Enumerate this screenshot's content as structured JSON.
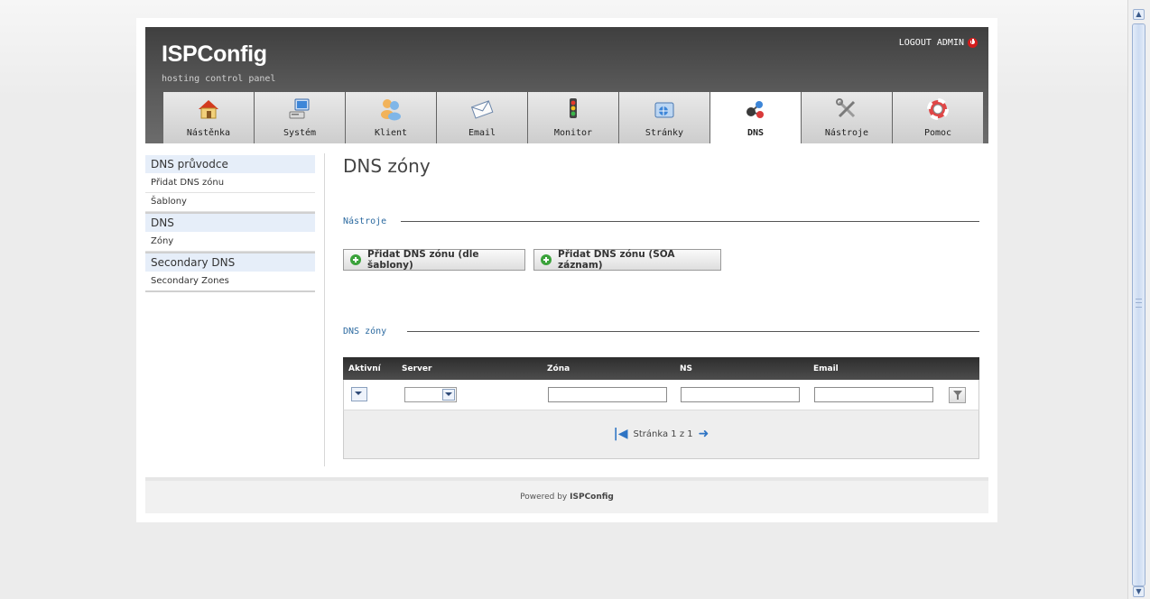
{
  "header": {
    "logo": "ISPConfig",
    "tagline": "hosting control panel",
    "logout_label": "LOGOUT ADMIN"
  },
  "tabs": [
    {
      "label": "Nástěnka",
      "icon": "home-icon"
    },
    {
      "label": "Systém",
      "icon": "computer-icon"
    },
    {
      "label": "Klient",
      "icon": "users-icon"
    },
    {
      "label": "Email",
      "icon": "envelope-icon"
    },
    {
      "label": "Monitor",
      "icon": "traffic-light-icon"
    },
    {
      "label": "Stránky",
      "icon": "web-folder-icon"
    },
    {
      "label": "DNS",
      "icon": "dns-molecule-icon",
      "active": true
    },
    {
      "label": "Nástroje",
      "icon": "tools-icon"
    },
    {
      "label": "Pomoc",
      "icon": "lifebuoy-icon"
    }
  ],
  "sidebar": {
    "sections": [
      {
        "title": "DNS průvodce",
        "items": [
          "Přidat DNS zónu",
          "Šablony"
        ]
      },
      {
        "title": "DNS",
        "items": [
          "Zóny"
        ]
      },
      {
        "title": "Secondary DNS",
        "items": [
          "Secondary Zones"
        ]
      }
    ]
  },
  "main": {
    "title": "DNS zóny",
    "tools_legend": "Nástroje",
    "buttons": [
      "Přidat DNS zónu (dle šablony)",
      "Přidat DNS zónu (SOA záznam)"
    ],
    "list_legend": "DNS zóny",
    "table": {
      "columns": [
        "Aktivní",
        "Server",
        "Zóna",
        "NS",
        "Email"
      ],
      "pager": "Stránka 1 z 1"
    }
  },
  "footer": {
    "prefix": "Powered by",
    "brand": "ISPConfig"
  },
  "colors": {
    "header_bg": "#4f4f4f",
    "link_blue": "#2c6aa0",
    "sidebar_head_bg": "#e6eef9",
    "logout_red": "#d41c1c",
    "add_green": "#3aa23a"
  }
}
